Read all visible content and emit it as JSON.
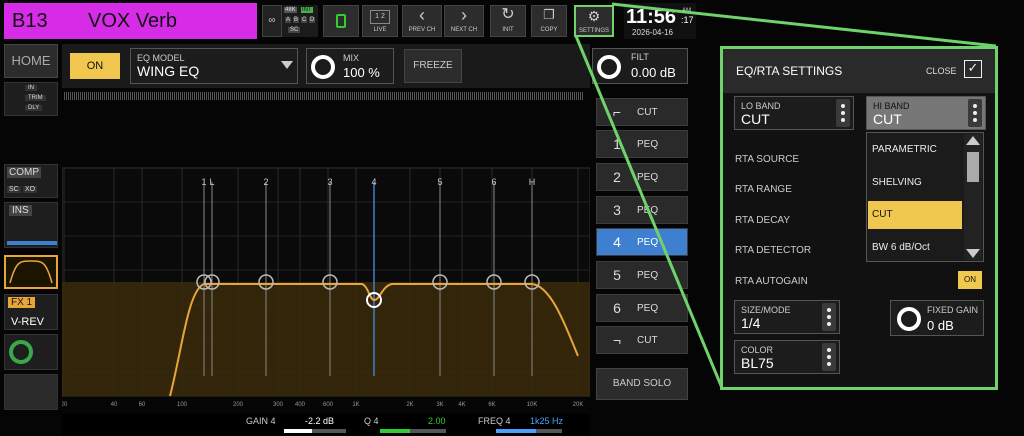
{
  "header": {
    "channel_id": "B13",
    "channel_name": "VOX Verb",
    "badges": [
      "48K",
      "INT",
      "A",
      "B",
      "C",
      "D",
      "SC"
    ],
    "live_label": "LIVE",
    "prev_label": "PREV CH",
    "next_label": "NEXT CH",
    "init_label": "INIT",
    "copy_label": "COPY",
    "settings_label": "SETTINGS",
    "clock": "11:56",
    "clock_ampm": "AM",
    "clock_sec": ":17",
    "date": "2026-04-16"
  },
  "left": {
    "home_label": "HOME",
    "strip_labels": [
      "IN",
      "TRIM",
      "DLY"
    ],
    "comp_label": "COMP",
    "sc_label": "SC",
    "xo_label": "XO",
    "ins_label": "INS",
    "fx_label": "FX 1",
    "fx_name": "V-REV"
  },
  "toolbar": {
    "on_label": "ON",
    "eq_model_label": "EQ MODEL",
    "eq_model_value": "WING EQ",
    "mix_label": "MIX",
    "mix_value": "100 %",
    "freeze_label": "FREEZE",
    "filt_label": "FILT",
    "filt_value": "0.00 dB"
  },
  "graph": {
    "band_markers": [
      "1",
      "L",
      "2",
      "3",
      "4",
      "5",
      "6",
      "H"
    ],
    "freq_ticks": [
      "20",
      "40",
      "60",
      "100",
      "200",
      "300",
      "400",
      "600",
      "1K",
      "2K",
      "3K",
      "4K",
      "6K",
      "10K",
      "20K"
    ]
  },
  "bottom": {
    "gain_label": "GAIN 4",
    "gain_value": "-2.2 dB",
    "q_label": "Q 4",
    "q_value": "2.00",
    "freq_label": "FREQ 4",
    "freq_value": "1k25 Hz",
    "gain_level": 0.45,
    "q_level": 0.45,
    "freq_level": 0.6
  },
  "bands": [
    {
      "num": "",
      "label": "CUT"
    },
    {
      "num": "1",
      "label": "PEQ"
    },
    {
      "num": "2",
      "label": "PEQ"
    },
    {
      "num": "3",
      "label": "PEQ"
    },
    {
      "num": "4",
      "label": "PEQ"
    },
    {
      "num": "5",
      "label": "PEQ"
    },
    {
      "num": "6",
      "label": "PEQ"
    },
    {
      "num": "",
      "label": "CUT"
    }
  ],
  "band_solo_label": "BAND SOLO",
  "panel": {
    "title": "EQ/RTA SETTINGS",
    "close_label": "CLOSE",
    "lo_band_label": "LO BAND",
    "lo_band_value": "CUT",
    "hi_band_label": "HI BAND",
    "hi_band_value": "CUT",
    "rta_source": "RTA SOURCE",
    "rta_range": "RTA RANGE",
    "rta_decay": "RTA DECAY",
    "rta_detector": "RTA DETECTOR",
    "rta_autogain": "RTA AUTOGAIN",
    "autogain_on": "ON",
    "size_mode_label": "SIZE/MODE",
    "size_mode_value": "1/4",
    "fixed_gain_label": "FIXED GAIN",
    "fixed_gain_value": "0 dB",
    "color_label": "COLOR",
    "color_value": "BL75",
    "dropdown_options": [
      "PARAMETRIC",
      "SHELVING",
      "CUT",
      "BW 6 dB/Oct"
    ]
  },
  "colors": {
    "accent_magenta": "#d62ce8",
    "accent_blue": "#3f7fd0",
    "accent_yellow": "#f0c850",
    "green_frame": "#6fd26a",
    "curve": "#e8a53a"
  }
}
